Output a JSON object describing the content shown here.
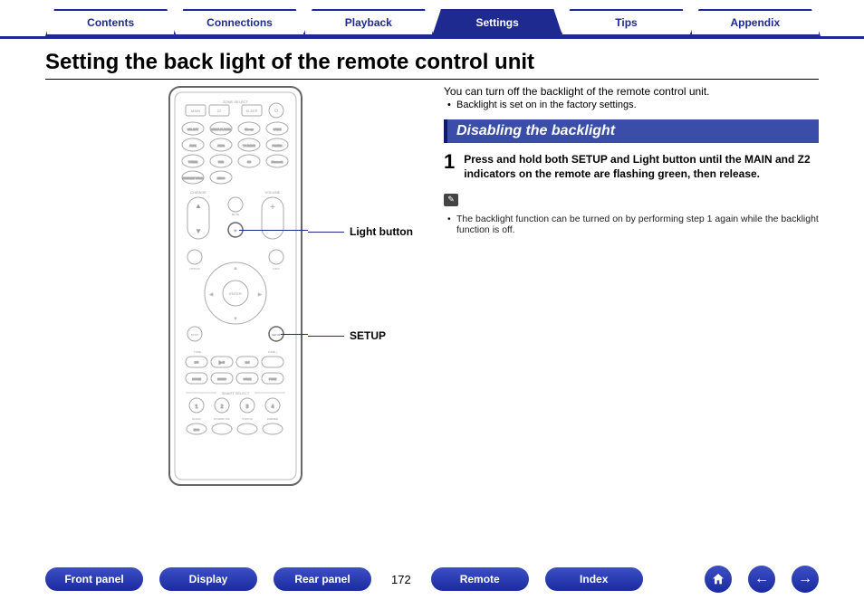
{
  "tabs": {
    "contents": "Contents",
    "connections": "Connections",
    "playback": "Playback",
    "settings": "Settings",
    "tips": "Tips",
    "appendix": "Appendix"
  },
  "page_title": "Setting the back light of the remote control unit",
  "callouts": {
    "light_button": "Light button",
    "setup": "SETUP"
  },
  "intro": "You can turn off the backlight of the remote control unit.",
  "intro_bullet": "Backlight is set on in the factory settings.",
  "section_header": "Disabling the backlight",
  "step1_num": "1",
  "step1_text": "Press and hold both SETUP and Light button until the MAIN and Z2 indicators on the remote are flashing green, then release.",
  "note_bullet": "The backlight function can be turned on by performing step 1 again while the backlight function is off.",
  "bottom": {
    "front_panel": "Front panel",
    "display": "Display",
    "rear_panel": "Rear panel",
    "page": "172",
    "remote": "Remote",
    "index": "Index"
  },
  "remote_labels": {
    "zone_select": "ZONE SELECT",
    "main": "MAIN",
    "z2": "Z2",
    "sleep": "SLEEP",
    "power": "",
    "cbl_sat": "CBL/SAT",
    "media_player": "MEDIA PLAYER",
    "bluray": "Blu-ray",
    "game": "GAME",
    "aux1": "AUX1",
    "aux2": "AUX2",
    "tv_audio": "TV AUDIO",
    "phono": "PHONO",
    "tuner": "TUNER",
    "usb": "USB",
    "cd": "CD",
    "bluetooth": "Bluetooth",
    "internet_radio": "INTERNET RADIO",
    "heos": "HEOS",
    "ch_page": "CH/PAGE",
    "volume": "VOLUME",
    "mute": "MUTE",
    "enter": "ENTER",
    "back": "BACK",
    "option": "OPTION",
    "setup_btn": "SETUP",
    "tune_minus": "TUNE -",
    "tune_plus": "TUNE +",
    "movie": "MOVIE",
    "music": "MUSIC",
    "game_mode": "GAME",
    "pure": "PURE",
    "smart_select": "SMART SELECT",
    "one": "1",
    "two": "2",
    "three": "3",
    "four": "4",
    "mdax": "M-DAX",
    "dynamic_vol": "DYNAMIC VOL",
    "info": "INFO",
    "eco": "ECO",
    "dimmer": "DIMMER",
    "status": "STATUS"
  }
}
